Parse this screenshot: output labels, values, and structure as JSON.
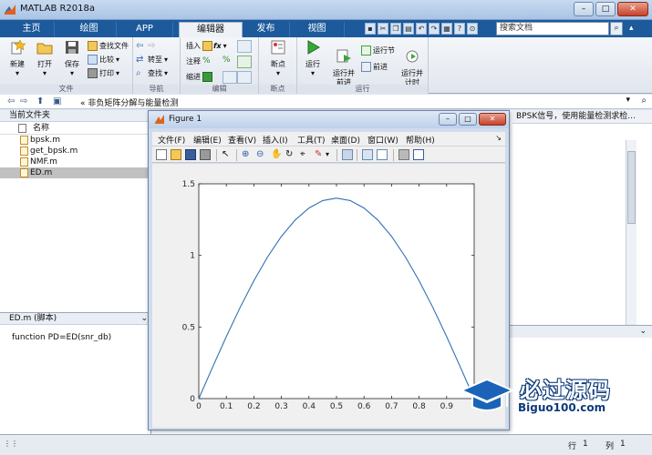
{
  "window": {
    "title": "MATLAB R2018a"
  },
  "tabs": [
    {
      "label": "主页"
    },
    {
      "label": "绘图"
    },
    {
      "label": "APP"
    },
    {
      "label": "编辑器"
    },
    {
      "label": "发布"
    },
    {
      "label": "视图"
    }
  ],
  "search": {
    "placeholder": "搜索文档"
  },
  "ribbon": {
    "file": {
      "label": "文件",
      "new": "新建",
      "open": "打开",
      "save": "保存",
      "find_files": "查找文件",
      "compare": "比较",
      "print": "打印"
    },
    "navigate": {
      "label": "导航",
      "goto": "转至",
      "find": "查找"
    },
    "edit": {
      "label": "编辑",
      "insert": "插入",
      "comment": "注释",
      "indent": "缩进",
      "fx": "fx"
    },
    "breakpoints": {
      "label": "断点",
      "breakpoints": "断点"
    },
    "run": {
      "label": "运行",
      "run": "运行",
      "run_advance": "运行并\n前进",
      "run_section": "运行节",
      "advance": "前进",
      "run_time": "运行并\n计时"
    }
  },
  "pathbar": {
    "path": "«  非负矩阵分解与能量检测"
  },
  "current_folder": {
    "title": "当前文件夹",
    "column": "名称",
    "files": [
      {
        "name": "bpsk.m"
      },
      {
        "name": "get_bpsk.m"
      },
      {
        "name": "NMF.m"
      },
      {
        "name": "ED.m"
      }
    ]
  },
  "details": {
    "title": "ED.m  (脚本)",
    "content": "function PD=ED(snr_db)"
  },
  "editor": {
    "snippet": "BPSK信号，使用能量检测求检..."
  },
  "status": {
    "row_label": "行",
    "row": "1",
    "col_label": "列",
    "col": "1"
  },
  "figure": {
    "title": "Figure 1",
    "menu": [
      "文件(F)",
      "编辑(E)",
      "查看(V)",
      "插入(I)",
      "工具(T)",
      "桌面(D)",
      "窗口(W)",
      "帮助(H)"
    ]
  },
  "watermark": {
    "title": "必过源码",
    "subtitle": "Biguo100.com"
  },
  "chart_data": {
    "type": "line",
    "x": [
      0,
      0.05,
      0.1,
      0.15,
      0.2,
      0.25,
      0.3,
      0.35,
      0.4,
      0.45,
      0.5,
      0.55,
      0.6,
      0.65,
      0.7,
      0.75,
      0.8,
      0.85,
      0.9,
      0.95,
      1.0
    ],
    "series": [
      {
        "values": [
          0,
          0.219,
          0.433,
          0.636,
          0.823,
          0.99,
          1.133,
          1.247,
          1.331,
          1.383,
          1.4,
          1.383,
          1.331,
          1.247,
          1.133,
          0.99,
          0.823,
          0.636,
          0.433,
          0.219,
          0
        ]
      }
    ],
    "xlim": [
      0,
      1
    ],
    "ylim": [
      0,
      1.5
    ],
    "xticks": [
      0,
      0.1,
      0.2,
      0.3,
      0.4,
      0.5,
      0.6,
      0.7,
      0.8,
      0.9
    ],
    "yticks": [
      0,
      0.5,
      1,
      1.5
    ],
    "color": "#2f6fb5",
    "grid": false
  }
}
